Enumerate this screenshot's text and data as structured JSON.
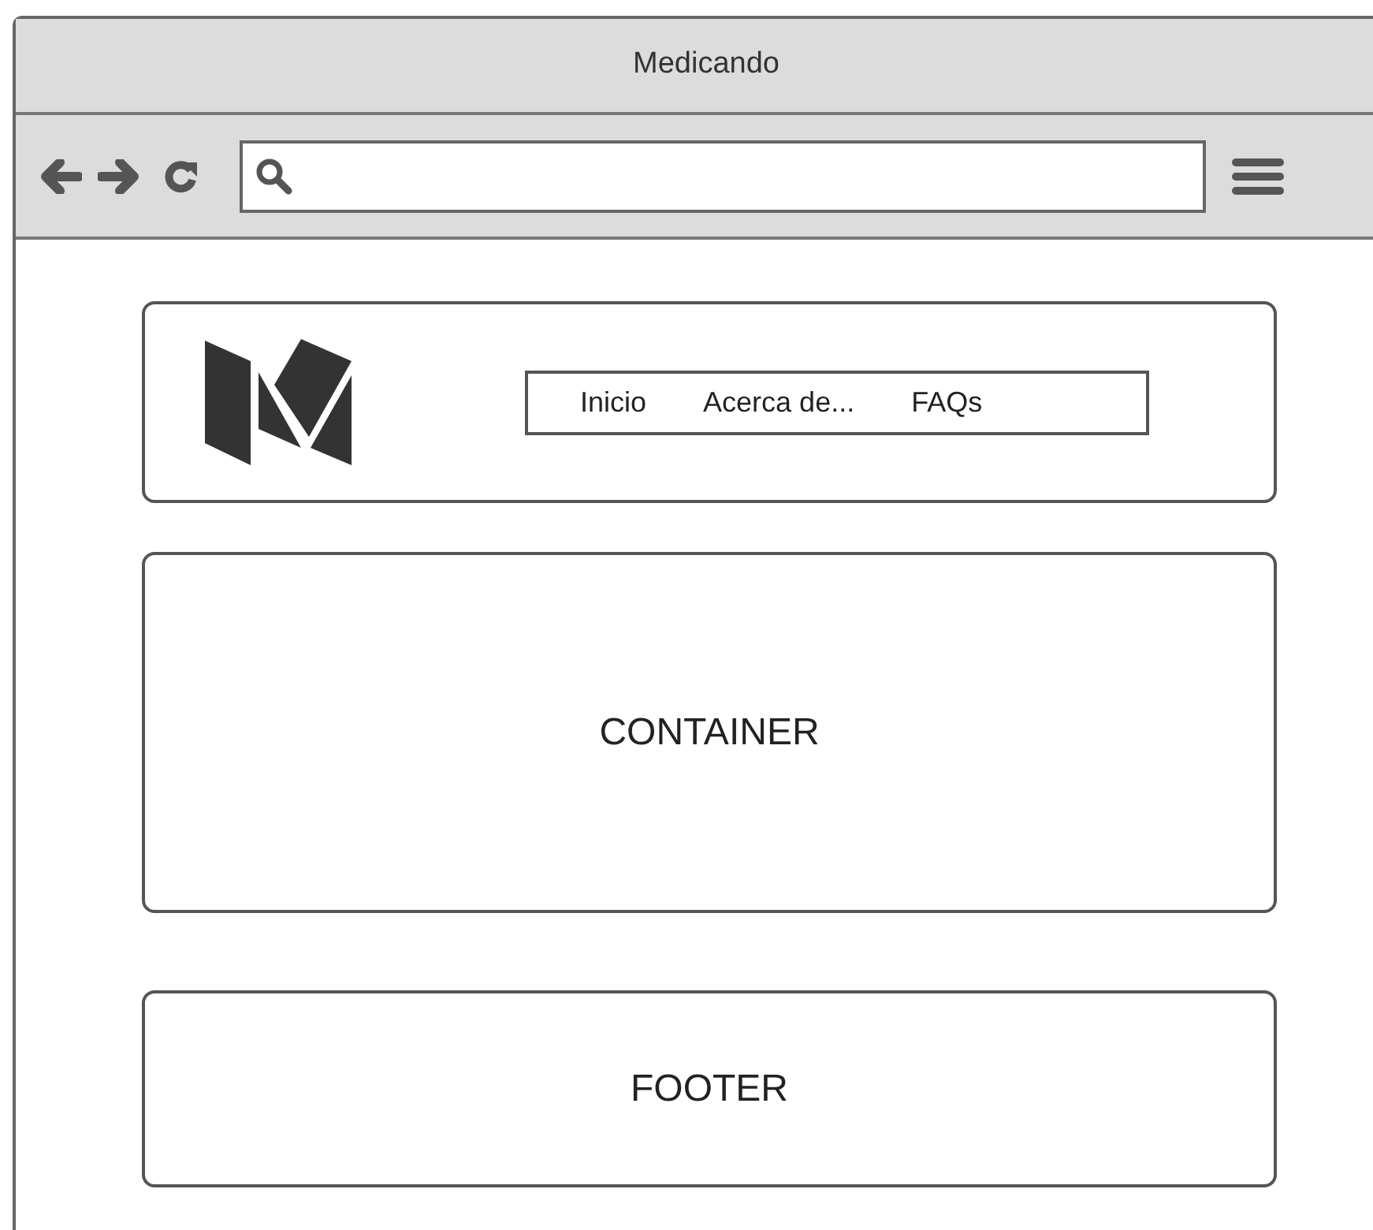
{
  "window": {
    "title": "Medicando"
  },
  "header": {
    "nav": [
      {
        "label": "Inicio"
      },
      {
        "label": "Acerca de..."
      },
      {
        "label": "FAQs"
      }
    ]
  },
  "container": {
    "label": "CONTAINER"
  },
  "footer": {
    "label": "FOOTER"
  }
}
